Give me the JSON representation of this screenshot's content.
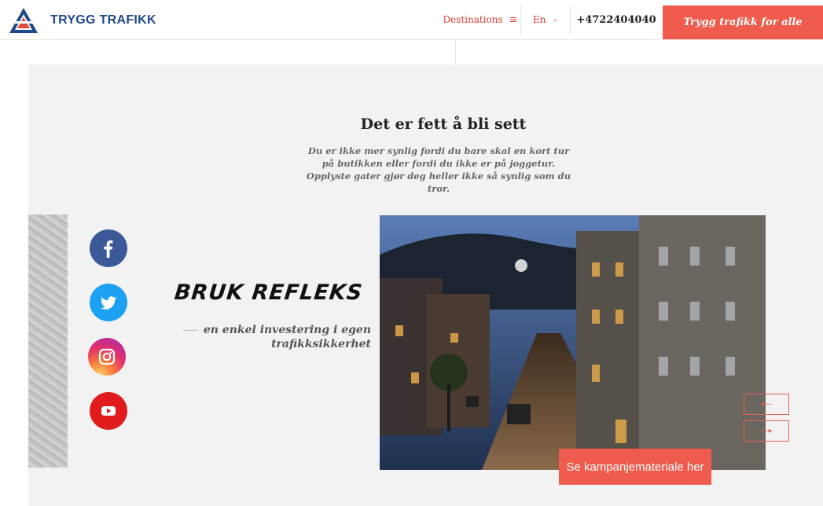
{
  "header": {
    "logo_text": "TRYGG TRAFIKK",
    "destinations_label": "Destinations",
    "language_label": "En",
    "phone": "+4722404040",
    "cta_label": "Trygg trafikk for alle"
  },
  "hero": {
    "title": "Det er fett å bli sett",
    "subtitle": "Du er ikke mer synlig fordi du bare skal en kort tur på butikken eller fordi du ikke er på joggetur. Opplyste gater gjør deg heller ikke så synlig som du tror."
  },
  "campaign": {
    "heading": "BRUK REFLEKS",
    "tagline": "en enkel investering i egen trafikksikkerhet",
    "button_label": "Se kampanjemateriale her"
  },
  "social": [
    "facebook-icon",
    "twitter-icon",
    "instagram-icon",
    "youtube-icon"
  ],
  "colors": {
    "accent": "#ef5b4c",
    "brand_blue": "#1f4a8a",
    "nav_red": "#d93c32",
    "background": "#f2f2f2"
  }
}
